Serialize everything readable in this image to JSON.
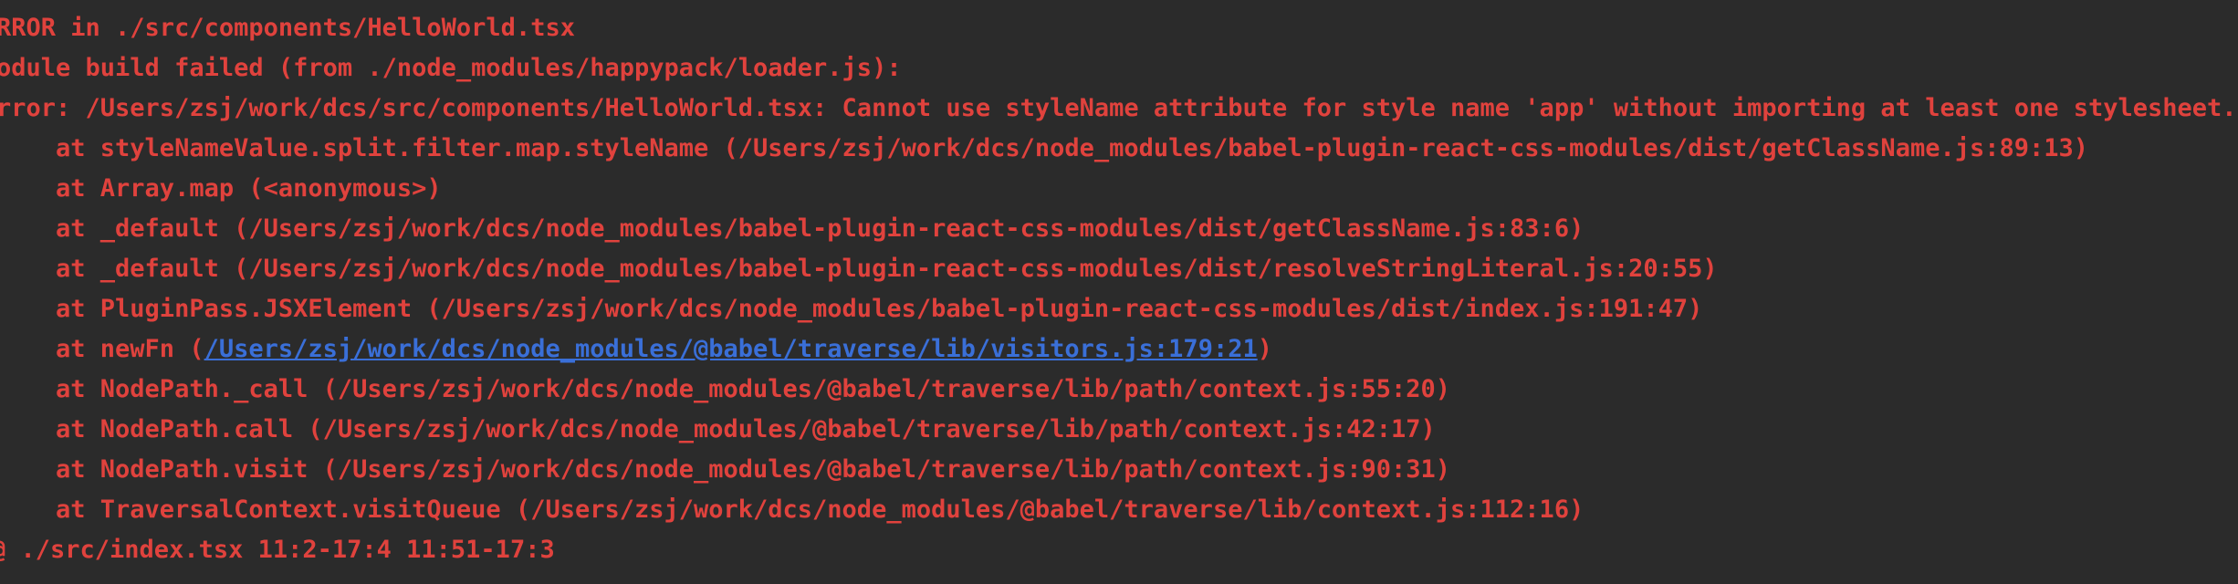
{
  "colors": {
    "background": "#2b2b2b",
    "error_text": "#e0423d",
    "link_text": "#3a6fd8"
  },
  "lines": {
    "l0": "RROR in ./src/components/HelloWorld.tsx",
    "l1": "odule build failed (from ./node_modules/happypack/loader.js):",
    "l2": "rror: /Users/zsj/work/dcs/src/components/HelloWorld.tsx: Cannot use styleName attribute for style name 'app' without importing at least one stylesheet.",
    "l3": "    at styleNameValue.split.filter.map.styleName (/Users/zsj/work/dcs/node_modules/babel-plugin-react-css-modules/dist/getClassName.js:89:13)",
    "l4": "    at Array.map (<anonymous>)",
    "l5": "    at _default (/Users/zsj/work/dcs/node_modules/babel-plugin-react-css-modules/dist/getClassName.js:83:6)",
    "l6": "    at _default (/Users/zsj/work/dcs/node_modules/babel-plugin-react-css-modules/dist/resolveStringLiteral.js:20:55)",
    "l7": "    at PluginPass.JSXElement (/Users/zsj/work/dcs/node_modules/babel-plugin-react-css-modules/dist/index.js:191:47)",
    "l8_prefix": "    at newFn (",
    "l8_link": "/Users/zsj/work/dcs/node_modules/@babel/traverse/lib/visitors.js:179:21",
    "l8_suffix": ")",
    "l9": "    at NodePath._call (/Users/zsj/work/dcs/node_modules/@babel/traverse/lib/path/context.js:55:20)",
    "l10": "    at NodePath.call (/Users/zsj/work/dcs/node_modules/@babel/traverse/lib/path/context.js:42:17)",
    "l11": "    at NodePath.visit (/Users/zsj/work/dcs/node_modules/@babel/traverse/lib/path/context.js:90:31)",
    "l12": "    at TraversalContext.visitQueue (/Users/zsj/work/dcs/node_modules/@babel/traverse/lib/context.js:112:16)",
    "l13": "@ ./src/index.tsx 11:2-17:4 11:51-17:3"
  }
}
